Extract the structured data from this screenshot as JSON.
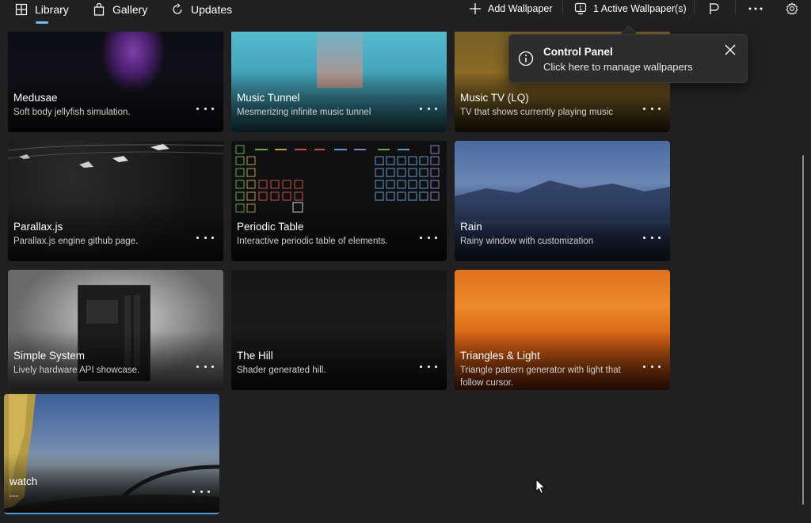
{
  "nav": {
    "library": "Library",
    "gallery": "Gallery",
    "updates": "Updates"
  },
  "actions": {
    "add_wallpaper": "Add Wallpaper",
    "active_wallpapers": "1 Active Wallpaper(s)"
  },
  "toast": {
    "title": "Control Panel",
    "subtitle": "Click here to manage wallpapers",
    "icon": "info-icon"
  },
  "cards": [
    {
      "title": "Medusae",
      "desc": "Soft body jellyfish simulation."
    },
    {
      "title": "Music Tunnel",
      "desc": "Mesmerizing infinite music tunnel"
    },
    {
      "title": "Music TV (LQ)",
      "desc": "TV that shows currently playing music"
    },
    {
      "title": "Parallax.js",
      "desc": "Parallax.js engine github page."
    },
    {
      "title": "Periodic Table",
      "desc": "Interactive periodic table of elements."
    },
    {
      "title": "Rain",
      "desc": "Rainy window with customization"
    },
    {
      "title": "Simple System",
      "desc": "Lively hardware API showcase."
    },
    {
      "title": "The Hill",
      "desc": "Shader generated hill."
    },
    {
      "title": "Triangles & Light",
      "desc": "Triangle pattern generator with light that follow cursor."
    },
    {
      "title": "watch",
      "desc": "---"
    }
  ],
  "colors": {
    "background": "#202020",
    "accent": "#76b9ed",
    "selection": "#4c9ddc"
  }
}
